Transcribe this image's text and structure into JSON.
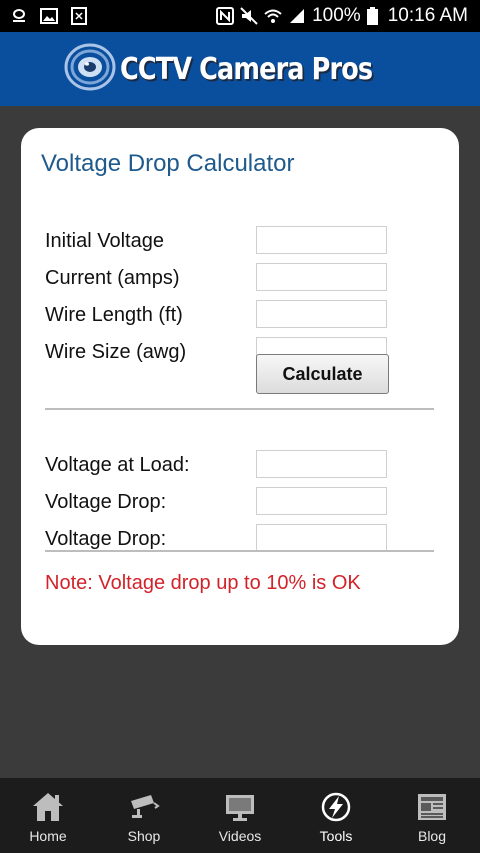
{
  "status_bar": {
    "battery": "100%",
    "time": "10:16 AM"
  },
  "header": {
    "logo_text": "CCTV Camera Pros"
  },
  "calculator": {
    "title": "Voltage Drop Calculator",
    "inputs": [
      {
        "label": "Initial Voltage",
        "value": ""
      },
      {
        "label": "Current (amps)",
        "value": ""
      },
      {
        "label": "Wire Length (ft)",
        "value": ""
      },
      {
        "label": "Wire Size (awg)",
        "value": ""
      }
    ],
    "calculate_label": "Calculate",
    "outputs": [
      {
        "label": "Voltage at Load:",
        "value": ""
      },
      {
        "label": "Voltage Drop:",
        "value": ""
      },
      {
        "label": "Voltage Drop:",
        "value": ""
      }
    ],
    "note": "Note: Voltage drop up to 10% is OK",
    "note_color": "#d2232a"
  },
  "bottom_nav": [
    {
      "label": "Home",
      "icon": "home-icon"
    },
    {
      "label": "Shop",
      "icon": "security-camera-icon"
    },
    {
      "label": "Videos",
      "icon": "monitor-icon"
    },
    {
      "label": "Tools",
      "icon": "lightning-icon"
    },
    {
      "label": "Blog",
      "icon": "newspaper-icon"
    }
  ],
  "colors": {
    "header_bg": "#0a4f9e",
    "title": "#1f5a8c",
    "nav_bg": "#1c1c1c"
  }
}
